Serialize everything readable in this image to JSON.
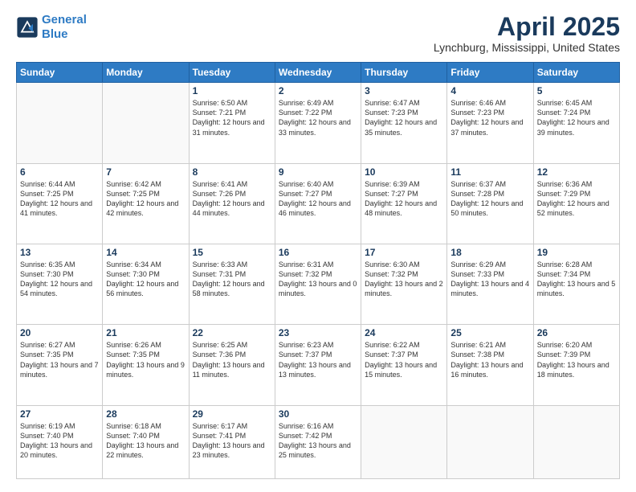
{
  "logo": {
    "line1": "General",
    "line2": "Blue"
  },
  "title": "April 2025",
  "subtitle": "Lynchburg, Mississippi, United States",
  "days": [
    "Sunday",
    "Monday",
    "Tuesday",
    "Wednesday",
    "Thursday",
    "Friday",
    "Saturday"
  ],
  "weeks": [
    [
      {
        "num": "",
        "sunrise": "",
        "sunset": "",
        "daylight": "",
        "empty": true
      },
      {
        "num": "",
        "sunrise": "",
        "sunset": "",
        "daylight": "",
        "empty": true
      },
      {
        "num": "1",
        "sunrise": "Sunrise: 6:50 AM",
        "sunset": "Sunset: 7:21 PM",
        "daylight": "Daylight: 12 hours and 31 minutes."
      },
      {
        "num": "2",
        "sunrise": "Sunrise: 6:49 AM",
        "sunset": "Sunset: 7:22 PM",
        "daylight": "Daylight: 12 hours and 33 minutes."
      },
      {
        "num": "3",
        "sunrise": "Sunrise: 6:47 AM",
        "sunset": "Sunset: 7:23 PM",
        "daylight": "Daylight: 12 hours and 35 minutes."
      },
      {
        "num": "4",
        "sunrise": "Sunrise: 6:46 AM",
        "sunset": "Sunset: 7:23 PM",
        "daylight": "Daylight: 12 hours and 37 minutes."
      },
      {
        "num": "5",
        "sunrise": "Sunrise: 6:45 AM",
        "sunset": "Sunset: 7:24 PM",
        "daylight": "Daylight: 12 hours and 39 minutes."
      }
    ],
    [
      {
        "num": "6",
        "sunrise": "Sunrise: 6:44 AM",
        "sunset": "Sunset: 7:25 PM",
        "daylight": "Daylight: 12 hours and 41 minutes."
      },
      {
        "num": "7",
        "sunrise": "Sunrise: 6:42 AM",
        "sunset": "Sunset: 7:25 PM",
        "daylight": "Daylight: 12 hours and 42 minutes."
      },
      {
        "num": "8",
        "sunrise": "Sunrise: 6:41 AM",
        "sunset": "Sunset: 7:26 PM",
        "daylight": "Daylight: 12 hours and 44 minutes."
      },
      {
        "num": "9",
        "sunrise": "Sunrise: 6:40 AM",
        "sunset": "Sunset: 7:27 PM",
        "daylight": "Daylight: 12 hours and 46 minutes."
      },
      {
        "num": "10",
        "sunrise": "Sunrise: 6:39 AM",
        "sunset": "Sunset: 7:27 PM",
        "daylight": "Daylight: 12 hours and 48 minutes."
      },
      {
        "num": "11",
        "sunrise": "Sunrise: 6:37 AM",
        "sunset": "Sunset: 7:28 PM",
        "daylight": "Daylight: 12 hours and 50 minutes."
      },
      {
        "num": "12",
        "sunrise": "Sunrise: 6:36 AM",
        "sunset": "Sunset: 7:29 PM",
        "daylight": "Daylight: 12 hours and 52 minutes."
      }
    ],
    [
      {
        "num": "13",
        "sunrise": "Sunrise: 6:35 AM",
        "sunset": "Sunset: 7:30 PM",
        "daylight": "Daylight: 12 hours and 54 minutes."
      },
      {
        "num": "14",
        "sunrise": "Sunrise: 6:34 AM",
        "sunset": "Sunset: 7:30 PM",
        "daylight": "Daylight: 12 hours and 56 minutes."
      },
      {
        "num": "15",
        "sunrise": "Sunrise: 6:33 AM",
        "sunset": "Sunset: 7:31 PM",
        "daylight": "Daylight: 12 hours and 58 minutes."
      },
      {
        "num": "16",
        "sunrise": "Sunrise: 6:31 AM",
        "sunset": "Sunset: 7:32 PM",
        "daylight": "Daylight: 13 hours and 0 minutes."
      },
      {
        "num": "17",
        "sunrise": "Sunrise: 6:30 AM",
        "sunset": "Sunset: 7:32 PM",
        "daylight": "Daylight: 13 hours and 2 minutes."
      },
      {
        "num": "18",
        "sunrise": "Sunrise: 6:29 AM",
        "sunset": "Sunset: 7:33 PM",
        "daylight": "Daylight: 13 hours and 4 minutes."
      },
      {
        "num": "19",
        "sunrise": "Sunrise: 6:28 AM",
        "sunset": "Sunset: 7:34 PM",
        "daylight": "Daylight: 13 hours and 5 minutes."
      }
    ],
    [
      {
        "num": "20",
        "sunrise": "Sunrise: 6:27 AM",
        "sunset": "Sunset: 7:35 PM",
        "daylight": "Daylight: 13 hours and 7 minutes."
      },
      {
        "num": "21",
        "sunrise": "Sunrise: 6:26 AM",
        "sunset": "Sunset: 7:35 PM",
        "daylight": "Daylight: 13 hours and 9 minutes."
      },
      {
        "num": "22",
        "sunrise": "Sunrise: 6:25 AM",
        "sunset": "Sunset: 7:36 PM",
        "daylight": "Daylight: 13 hours and 11 minutes."
      },
      {
        "num": "23",
        "sunrise": "Sunrise: 6:23 AM",
        "sunset": "Sunset: 7:37 PM",
        "daylight": "Daylight: 13 hours and 13 minutes."
      },
      {
        "num": "24",
        "sunrise": "Sunrise: 6:22 AM",
        "sunset": "Sunset: 7:37 PM",
        "daylight": "Daylight: 13 hours and 15 minutes."
      },
      {
        "num": "25",
        "sunrise": "Sunrise: 6:21 AM",
        "sunset": "Sunset: 7:38 PM",
        "daylight": "Daylight: 13 hours and 16 minutes."
      },
      {
        "num": "26",
        "sunrise": "Sunrise: 6:20 AM",
        "sunset": "Sunset: 7:39 PM",
        "daylight": "Daylight: 13 hours and 18 minutes."
      }
    ],
    [
      {
        "num": "27",
        "sunrise": "Sunrise: 6:19 AM",
        "sunset": "Sunset: 7:40 PM",
        "daylight": "Daylight: 13 hours and 20 minutes."
      },
      {
        "num": "28",
        "sunrise": "Sunrise: 6:18 AM",
        "sunset": "Sunset: 7:40 PM",
        "daylight": "Daylight: 13 hours and 22 minutes."
      },
      {
        "num": "29",
        "sunrise": "Sunrise: 6:17 AM",
        "sunset": "Sunset: 7:41 PM",
        "daylight": "Daylight: 13 hours and 23 minutes."
      },
      {
        "num": "30",
        "sunrise": "Sunrise: 6:16 AM",
        "sunset": "Sunset: 7:42 PM",
        "daylight": "Daylight: 13 hours and 25 minutes."
      },
      {
        "num": "",
        "sunrise": "",
        "sunset": "",
        "daylight": "",
        "empty": true
      },
      {
        "num": "",
        "sunrise": "",
        "sunset": "",
        "daylight": "",
        "empty": true
      },
      {
        "num": "",
        "sunrise": "",
        "sunset": "",
        "daylight": "",
        "empty": true
      }
    ]
  ]
}
